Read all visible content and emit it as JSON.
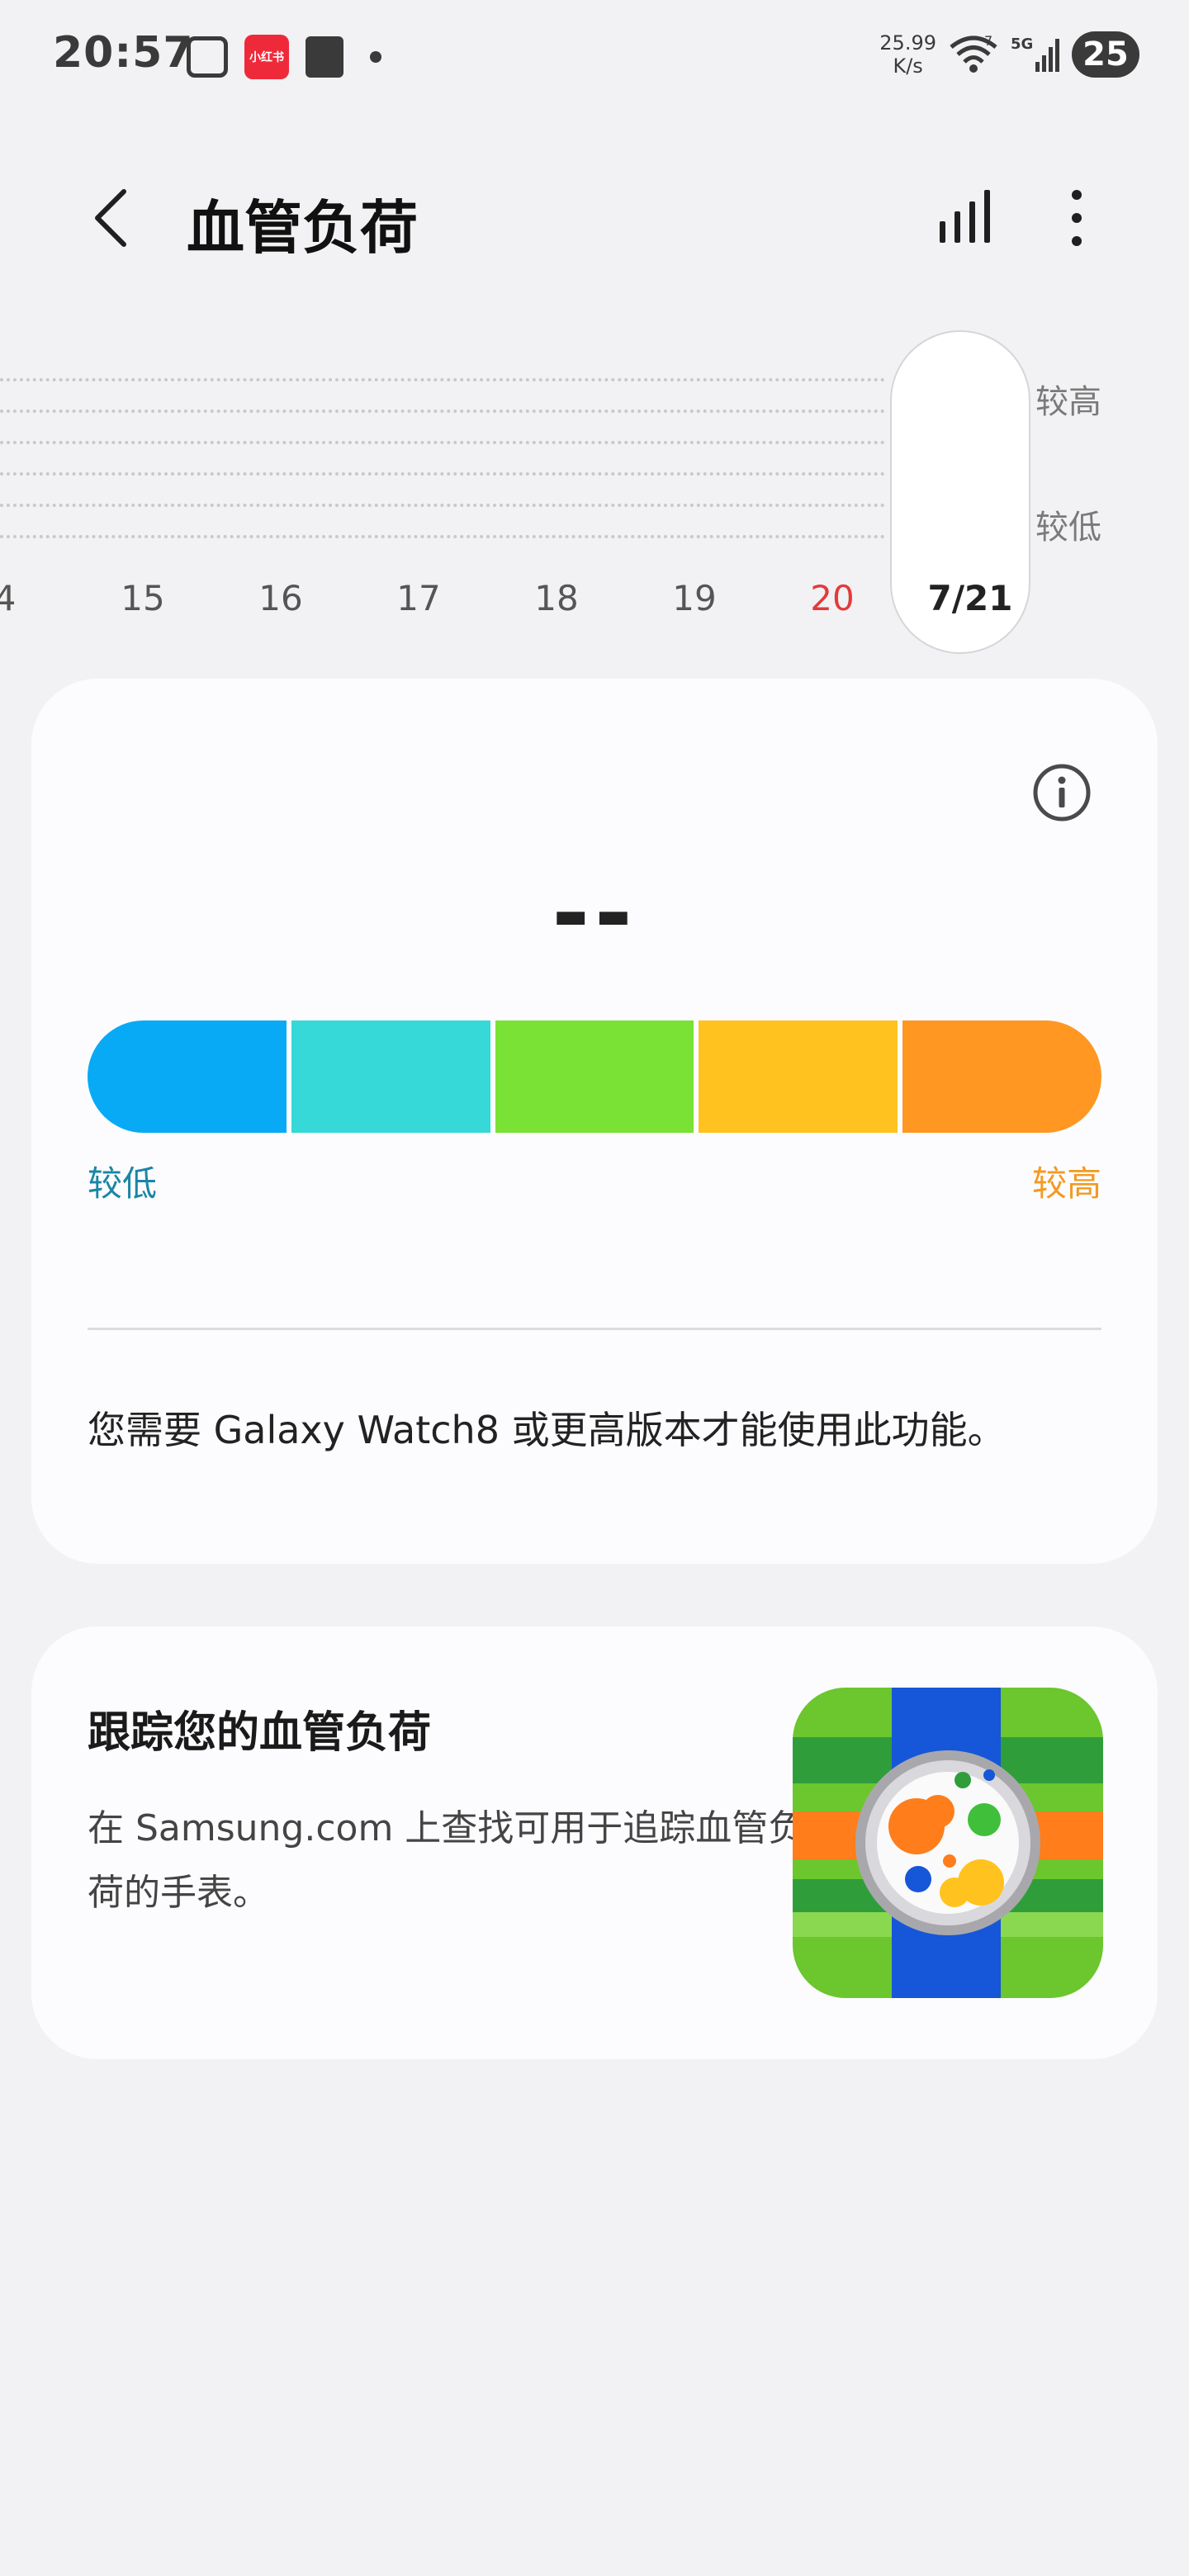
{
  "status_bar": {
    "time": "20:57",
    "red_app_label": "小红书",
    "net_speed_value": "25.99",
    "net_speed_unit": "K/s",
    "wifi_badge": "7",
    "signal_label": "5G",
    "battery": "25"
  },
  "header": {
    "title": "血管负荷"
  },
  "chart": {
    "high_label": "较高",
    "low_label": "较低",
    "dates": [
      {
        "label": "4"
      },
      {
        "label": "15"
      },
      {
        "label": "16"
      },
      {
        "label": "17"
      },
      {
        "label": "18"
      },
      {
        "label": "19"
      },
      {
        "label": "20",
        "color": "#e23b3b"
      },
      {
        "label": "7/21",
        "selected": true
      }
    ]
  },
  "summary_card": {
    "value": "--",
    "scale_colors": [
      "#08aaf5",
      "#36d8d8",
      "#79e234",
      "#ffc21f",
      "#ff9722"
    ],
    "scale_low_label": "较低",
    "scale_high_label": "较高",
    "requirement_text": "您需要 Galaxy Watch8 或更高版本才能使用此功能。"
  },
  "promo_card": {
    "title": "跟踪您的血管负荷",
    "description": "在 Samsung.com 上查找可用于追踪血管负荷的手表。"
  }
}
